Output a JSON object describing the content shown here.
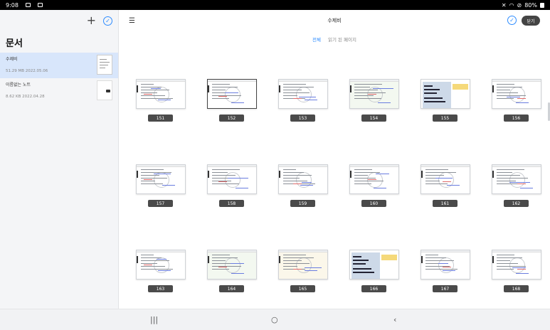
{
  "status_bar": {
    "time": "9:08",
    "battery": "80%"
  },
  "sidebar": {
    "title": "문서",
    "documents": [
      {
        "name": "수제비",
        "meta": "51.29 MB  2022.05.06",
        "selected": true
      },
      {
        "name": "이름없는 노트",
        "meta": "8.62 KB  2022.04.28",
        "selected": false
      }
    ]
  },
  "header": {
    "title": "수제비",
    "close_label": "닫기"
  },
  "tabs": {
    "all": "전체",
    "read": "읽기 된 페이지"
  },
  "pages": [
    {
      "num": "151",
      "style": "doc"
    },
    {
      "num": "152",
      "style": "doc",
      "selected": true
    },
    {
      "num": "153",
      "style": "doc"
    },
    {
      "num": "154",
      "style": "green"
    },
    {
      "num": "155",
      "style": "slide"
    },
    {
      "num": "156",
      "style": "doc"
    },
    {
      "num": "157",
      "style": "doc"
    },
    {
      "num": "158",
      "style": "doc"
    },
    {
      "num": "159",
      "style": "doc"
    },
    {
      "num": "160",
      "style": "doc"
    },
    {
      "num": "161",
      "style": "doc"
    },
    {
      "num": "162",
      "style": "doc"
    },
    {
      "num": "163",
      "style": "doc"
    },
    {
      "num": "164",
      "style": "green"
    },
    {
      "num": "165",
      "style": "tinted"
    },
    {
      "num": "166",
      "style": "slide"
    },
    {
      "num": "167",
      "style": "doc"
    },
    {
      "num": "168",
      "style": "doc"
    }
  ],
  "icons": {
    "add": "plus-icon",
    "select": "check-circle-icon",
    "menu": "menu-icon",
    "nav_recents": "recents-icon",
    "nav_home": "home-icon",
    "nav_back": "back-icon"
  }
}
